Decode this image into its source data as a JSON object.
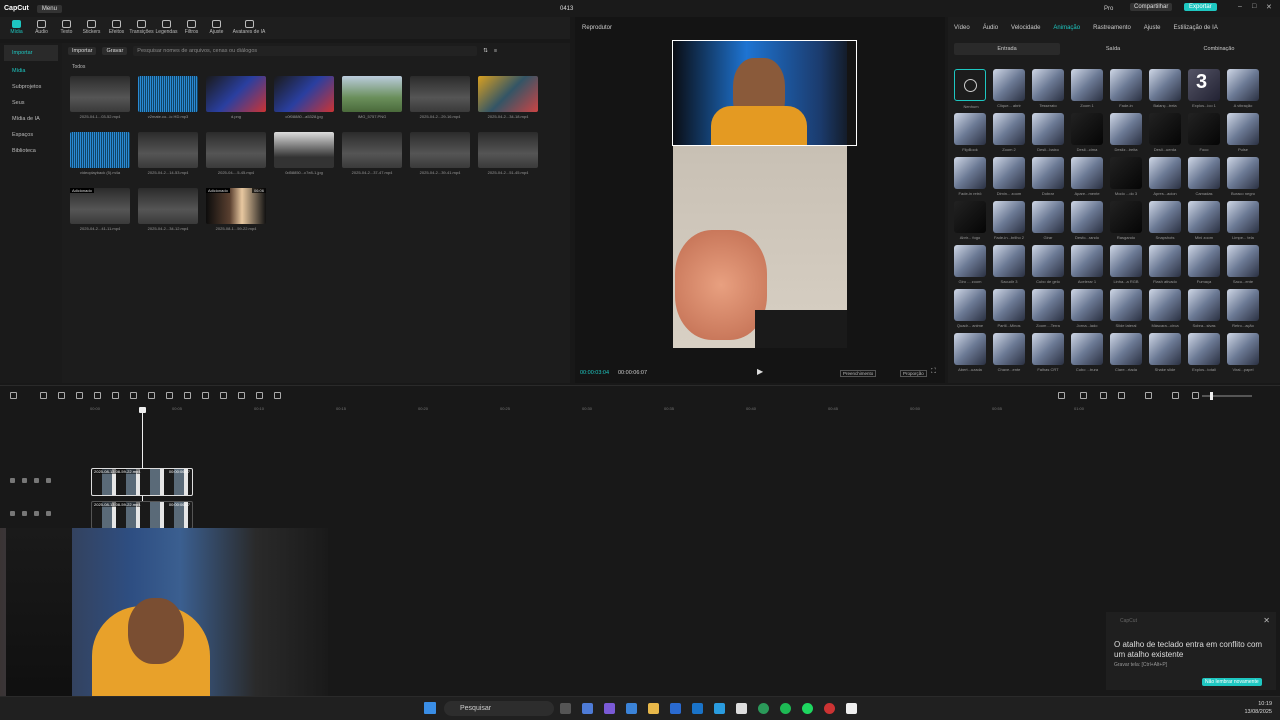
{
  "titlebar": {
    "logo": "CapCut",
    "menu": "Menu",
    "title": "0413",
    "pro": "Pro",
    "share": "Compartilhar",
    "export": "Exportar"
  },
  "toolbar": [
    {
      "label": "Mídia",
      "active": true
    },
    {
      "label": "Áudio"
    },
    {
      "label": "Texto"
    },
    {
      "label": "Stickers"
    },
    {
      "label": "Efeitos"
    },
    {
      "label": "Transições"
    },
    {
      "label": "Legendas"
    },
    {
      "label": "Filtros"
    },
    {
      "label": "Ajuste"
    },
    {
      "label": "Avatares de IA"
    }
  ],
  "sidebar": [
    {
      "label": "Importar",
      "sel": true
    },
    {
      "label": "Mídia",
      "sel": true
    },
    {
      "label": "Subprojetos"
    },
    {
      "label": "Seus"
    },
    {
      "label": "Mídia de IA"
    },
    {
      "label": "Espaços"
    },
    {
      "label": "Biblioteca"
    }
  ],
  "media": {
    "import": "Importar",
    "record": "Gravar",
    "search_placeholder": "Pesquisar nomes de arquivos, cenas ou diálogos",
    "section": "Todos",
    "items": [
      {
        "cap": "2025-04-1...03-52.mp4",
        "style": "gray"
      },
      {
        "cap": "v2mate.co...ic HD.mp3",
        "style": "wave"
      },
      {
        "cap": "d.png",
        "style": "photo"
      },
      {
        "cap": "c0f08880...a5328.jpg",
        "style": "photo"
      },
      {
        "cap": "IMG_5757.PNG",
        "style": "green"
      },
      {
        "cap": "2025-04-2...29-16.mp4",
        "style": "gray"
      },
      {
        "cap": "2025-04-2...34-18.mp4",
        "style": "game"
      },
      {
        "cap": "videoplayback (5).m4a",
        "style": "wave"
      },
      {
        "cap": "2025-04-2...14-53.mp4",
        "style": "gray"
      },
      {
        "cap": "2025-04-...5-45.mp4",
        "style": "gray"
      },
      {
        "cap": "0d58850...c7e8-1.jpg",
        "style": "person"
      },
      {
        "cap": "2025-04-2...37-47.mp4",
        "style": "gray"
      },
      {
        "cap": "2025-04-2...39-41.mp4",
        "style": "gray"
      },
      {
        "cap": "2025-04-2...51-45.mp4",
        "style": "gray"
      },
      {
        "cap": "2025-04-2...41-11.mp4",
        "style": "gray",
        "tag": "Adicionado"
      },
      {
        "cap": "2025-04-2...34-12.mp4",
        "style": "gray"
      },
      {
        "cap": "2025-08-1...59-22.mp4",
        "style": "dark",
        "tag": "Adicionado",
        "dur": "06:06"
      }
    ]
  },
  "player": {
    "title": "Reprodutor",
    "time_current": "00:00:03:04",
    "time_total": "00:00:06:07",
    "fit": "Preenchimento",
    "ratio": "Proporção"
  },
  "panel": {
    "tabs": [
      {
        "label": "Vídeo"
      },
      {
        "label": "Áudio"
      },
      {
        "label": "Velocidade"
      },
      {
        "label": "Animação",
        "sel": true
      },
      {
        "label": "Rastreamento"
      },
      {
        "label": "Ajuste"
      },
      {
        "label": "Estilização de IA"
      }
    ],
    "subtabs": [
      {
        "label": "Entrada",
        "sel": true
      },
      {
        "label": "Saída"
      },
      {
        "label": "Combinação"
      }
    ],
    "effects": [
      "Nenhum",
      "Clique... abrir",
      "Tesserato",
      "Zoom 1",
      "Fade-in",
      "Balanç...trela",
      "Explos...ico 1",
      "A vibração",
      "FlipBook",
      "Zoom 2",
      "Desli...baixo",
      "Desli...cima",
      "Desliz...ireita",
      "Desli...uerda",
      "Foco",
      "Pulse",
      "Fade-in retrô",
      "Dimin... zoom",
      "Dobrar",
      "Apare...mente",
      "Modo ...do 3",
      "Apres...acion",
      "Camadas",
      "Buraco negro",
      "Abrir... fogo",
      "Fade-in...brilho 2",
      "Girar",
      "Desfo...rando",
      "Rasgando",
      "Snapshots",
      "Mini zoom",
      "Limpe... tela",
      "Giro ... zoom",
      "Sacudir 3",
      "Cubo de gelo",
      "Acelerar 1",
      "Linha...a RGB",
      "Flash ativado",
      "Fumaça",
      "Sacu...ente",
      "Quadr... anime",
      "Partil...Minos",
      "Zoom ...Terra",
      "Jorna...lado",
      "Slide lateral",
      "Máscara...circa",
      "Sobra...sivas",
      "Retro...ação",
      "Abert...uzada",
      "Chave...ente",
      "Falhas CRT",
      "Cubo ...trura",
      "Clare...rtada",
      "Shake slide",
      "Explos...totali",
      "Viral...papel"
    ]
  },
  "timeline": {
    "ruler": [
      "00:00",
      "00:05",
      "00:10",
      "00:15",
      "00:20",
      "00:25",
      "00:30",
      "00:35",
      "00:40",
      "00:45",
      "00:50",
      "00:55",
      "01:00"
    ],
    "clip1_name": "2025-08-13 08-59-22.mp4",
    "clip1_dur": "00:00:06:07",
    "clip2_name": "2025-08-13 08-59-22.mp4",
    "clip2_dur": "00:00:06:07"
  },
  "toast": {
    "brand": "CapCut",
    "message": "O atalho de teclado entra em conflito com um atalho existente",
    "sub": "Gravar tela: [Ctrl+Alt+P]",
    "button": "Não lembrar novamente"
  },
  "taskbar": {
    "search": "Pesquisar",
    "time": "10:19",
    "date": "13/08/2025"
  },
  "accent": "#1ec7c1"
}
